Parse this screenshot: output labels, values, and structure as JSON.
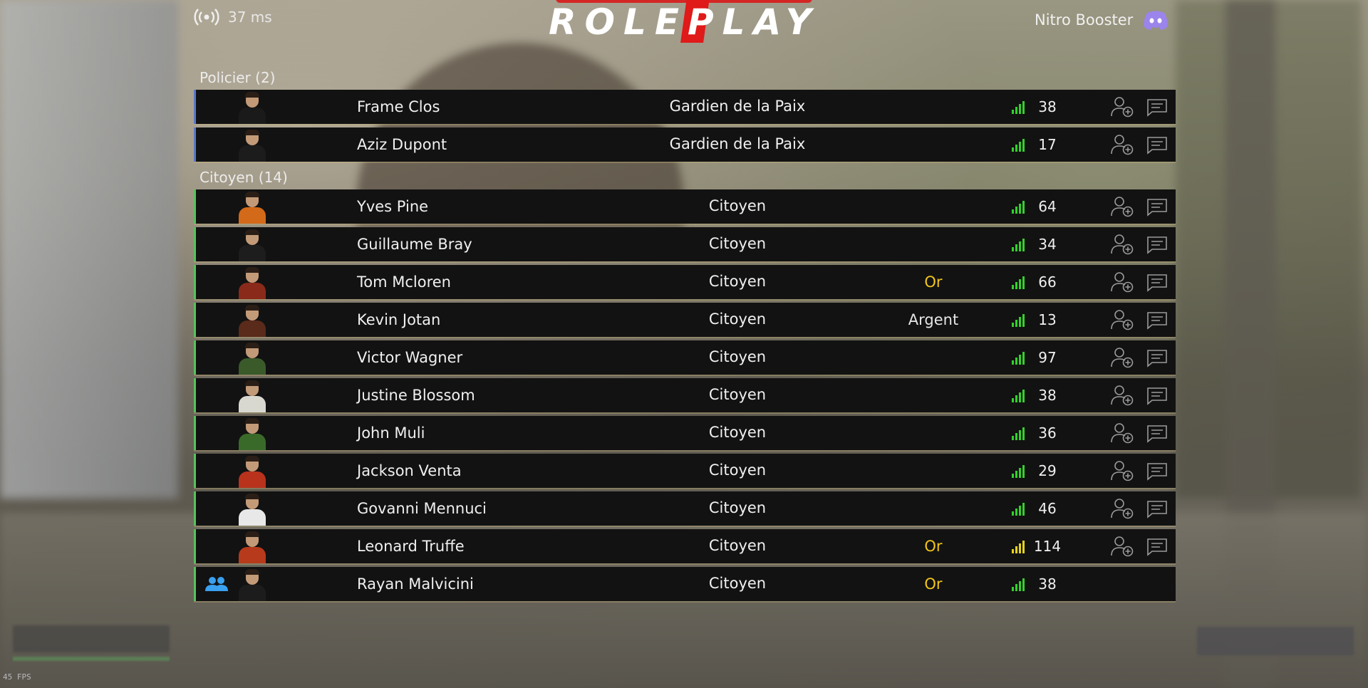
{
  "header": {
    "ping_label": "37 ms",
    "logo_text": "ROLEPLAY",
    "nitro_label": "Nitro Booster"
  },
  "colors": {
    "police_accent": "#5a78c8",
    "citizen_accent": "#58c25a",
    "rank_gold": "#f2c51a",
    "signal_good": "#34d12c",
    "signal_medium": "#e8d21a",
    "discord": "#9b84ec",
    "friends_icon": "#3aa0f0"
  },
  "groups": [
    {
      "title": "Policier (2)",
      "players": [
        {
          "name": "Frame Clos",
          "job": "Gardien de la Paix",
          "rank": "",
          "ping": "38"
        },
        {
          "name": "Aziz Dupont",
          "job": "Gardien de la Paix",
          "rank": "",
          "ping": "17"
        }
      ]
    },
    {
      "title": "Citoyen (14)",
      "players": [
        {
          "name": "Yves Pine",
          "job": "Citoyen",
          "rank": "",
          "ping": "64"
        },
        {
          "name": "Guillaume Bray",
          "job": "Citoyen",
          "rank": "",
          "ping": "34"
        },
        {
          "name": "Tom Mcloren",
          "job": "Citoyen",
          "rank": "Or",
          "ping": "66"
        },
        {
          "name": "Kevin Jotan",
          "job": "Citoyen",
          "rank": "Argent",
          "ping": "13"
        },
        {
          "name": "Victor Wagner",
          "job": "Citoyen",
          "rank": "",
          "ping": "97"
        },
        {
          "name": "Justine Blossom",
          "job": "Citoyen",
          "rank": "",
          "ping": "38"
        },
        {
          "name": "John Muli",
          "job": "Citoyen",
          "rank": "",
          "ping": "36"
        },
        {
          "name": "Jackson Venta",
          "job": "Citoyen",
          "rank": "",
          "ping": "29"
        },
        {
          "name": "Govanni Mennuci",
          "job": "Citoyen",
          "rank": "",
          "ping": "46"
        },
        {
          "name": "Leonard Truffe",
          "job": "Citoyen",
          "rank": "Or",
          "ping": "114"
        },
        {
          "name": "Rayan Malvicini",
          "job": "Citoyen",
          "rank": "Or",
          "ping": "38"
        }
      ]
    }
  ],
  "hud": {
    "fps_label": "45 FPS"
  }
}
